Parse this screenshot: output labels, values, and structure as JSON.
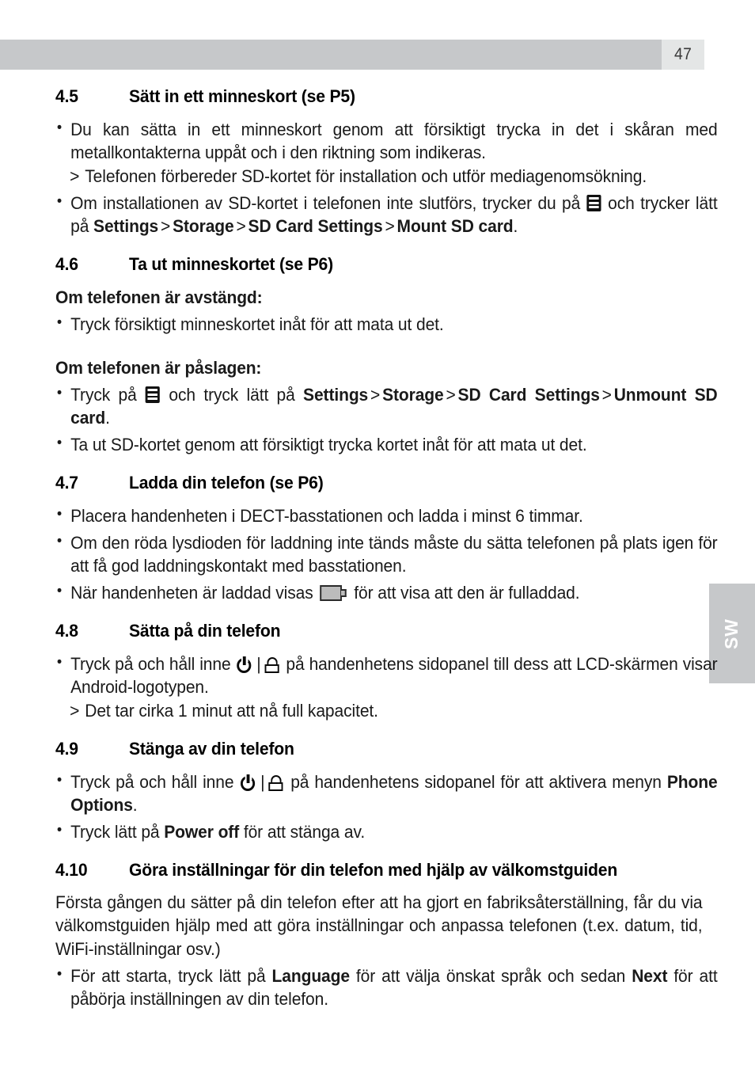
{
  "header": {
    "page_number": "47"
  },
  "side_tab": {
    "label": "SW"
  },
  "sections": {
    "s45": {
      "number": "4.5",
      "title": "Sätt in ett minneskort (se P5)",
      "b1": "Du kan sätta in ett minneskort genom att försiktigt trycka in det i skåran med metallkontakterna uppåt och i den riktning som indikeras.",
      "b1_sub": "Telefonen förbereder SD-kortet för installation och utför mediagenomsökning.",
      "b2_pre": "Om installationen av SD-kortet i telefonen inte slutförs, trycker du på ",
      "b2_mid": " och trycker lätt på ",
      "b2_settings": "Settings",
      "b2_storage": "Storage",
      "b2_sdcard": "SD Card Settings",
      "b2_mount": "Mount SD card",
      "b2_end": ".",
      "arrow": ">"
    },
    "s46": {
      "number": "4.6",
      "title": "Ta ut minneskortet (se P6)",
      "subhead_off": "Om telefonen är avstängd:",
      "b1": "Tryck försiktigt minneskortet inåt för att mata ut det.",
      "subhead_on": "Om telefonen är påslagen:",
      "b2_pre": "Tryck på ",
      "b2_mid": " och tryck lätt på ",
      "b2_settings": "Settings",
      "b2_storage": "Storage",
      "b2_sdcard": "SD Card Settings",
      "b2_unmount": "Unmount SD card",
      "b2_end": ".",
      "b3": "Ta ut SD-kortet genom att försiktigt trycka kortet inåt för att mata ut det.",
      "arrow": ">"
    },
    "s47": {
      "number": "4.7",
      "title": "Ladda din telefon (se P6)",
      "b1": "Placera handenheten i DECT-basstationen och ladda i minst 6 timmar.",
      "b2": "Om den röda lysdioden för laddning inte tänds måste du sätta telefonen på plats igen för att få god laddningskontakt med basstationen.",
      "b3_pre": "När handenheten är laddad visas ",
      "b3_post": " för att visa att den är fulladdad."
    },
    "s48": {
      "number": "4.8",
      "title": "Sätta på din telefon",
      "b1_pre": "Tryck på och håll inne ",
      "b1_post": " på handenhetens sidopanel till dess att LCD-skärmen visar Android-logotypen.",
      "b1_sub": "Det tar cirka 1 minut att nå full kapacitet.",
      "divider": "|"
    },
    "s49": {
      "number": "4.9",
      "title": "Stänga av din telefon",
      "b1_pre": "Tryck på och håll inne ",
      "b1_mid": " på handenhetens sidopanel för att aktivera menyn ",
      "b1_bold": "Phone Options",
      "b1_end": ".",
      "b2_pre": "Tryck lätt på ",
      "b2_bold": "Power off",
      "b2_post": " för att stänga av.",
      "divider": "|"
    },
    "s410": {
      "number": "4.10",
      "title": "Göra inställningar för din telefon med hjälp av välkomstguiden",
      "para": "Första gången du sätter på din telefon efter att ha gjort en fabriksåterställning, får du via välkomstguiden hjälp med att göra inställningar och anpassa telefonen (t.ex. datum, tid, WiFi-inställningar osv.)",
      "b1_pre": "För att starta, tryck lätt på ",
      "b1_bold1": "Language",
      "b1_mid": " för att välja önskat språk och sedan ",
      "b1_bold2": "Next",
      "b1_end": " för att påbörja inställningen av din telefon."
    }
  },
  "icons": {
    "menu": "menu-icon",
    "battery": "battery-full-icon",
    "power": "power-icon",
    "lock": "lock-icon"
  },
  "colors": {
    "header_bar": "#c6c8ca",
    "header_page_box": "#e4e6e6",
    "side_tab": "#c6c8ca",
    "text": "#1a1a1a"
  }
}
